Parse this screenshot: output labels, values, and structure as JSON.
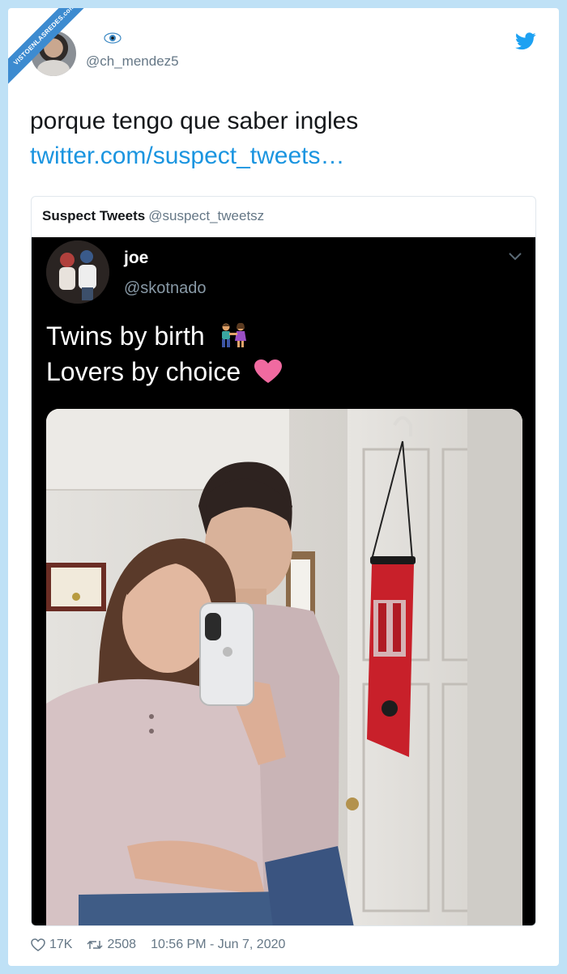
{
  "watermark": {
    "text": "VISTOENLASREDES.com"
  },
  "tweet": {
    "handle": "@ch_mendez5",
    "text": "porque tengo que saber ingles",
    "link": "twitter.com/suspect_tweets…",
    "likes": "17K",
    "retweets": "2508",
    "timestamp": "10:56 PM - Jun 7, 2020"
  },
  "quoted": {
    "name": "Suspect Tweets",
    "handle": "@suspect_tweetsz"
  },
  "screenshot": {
    "name": "joe",
    "handle": "@skotnado",
    "line1": "Twins by birth",
    "line2": "Lovers by choice"
  },
  "colors": {
    "background": "#bfe1f6",
    "link": "#1b95e0",
    "twitter_blue": "#1da1f2",
    "muted": "#657786"
  },
  "icons": [
    "eye-icon",
    "twitter-bird-icon",
    "chevron-down-icon",
    "couple-emoji-icon",
    "heart-emoji-icon",
    "like-icon",
    "retweet-icon"
  ]
}
